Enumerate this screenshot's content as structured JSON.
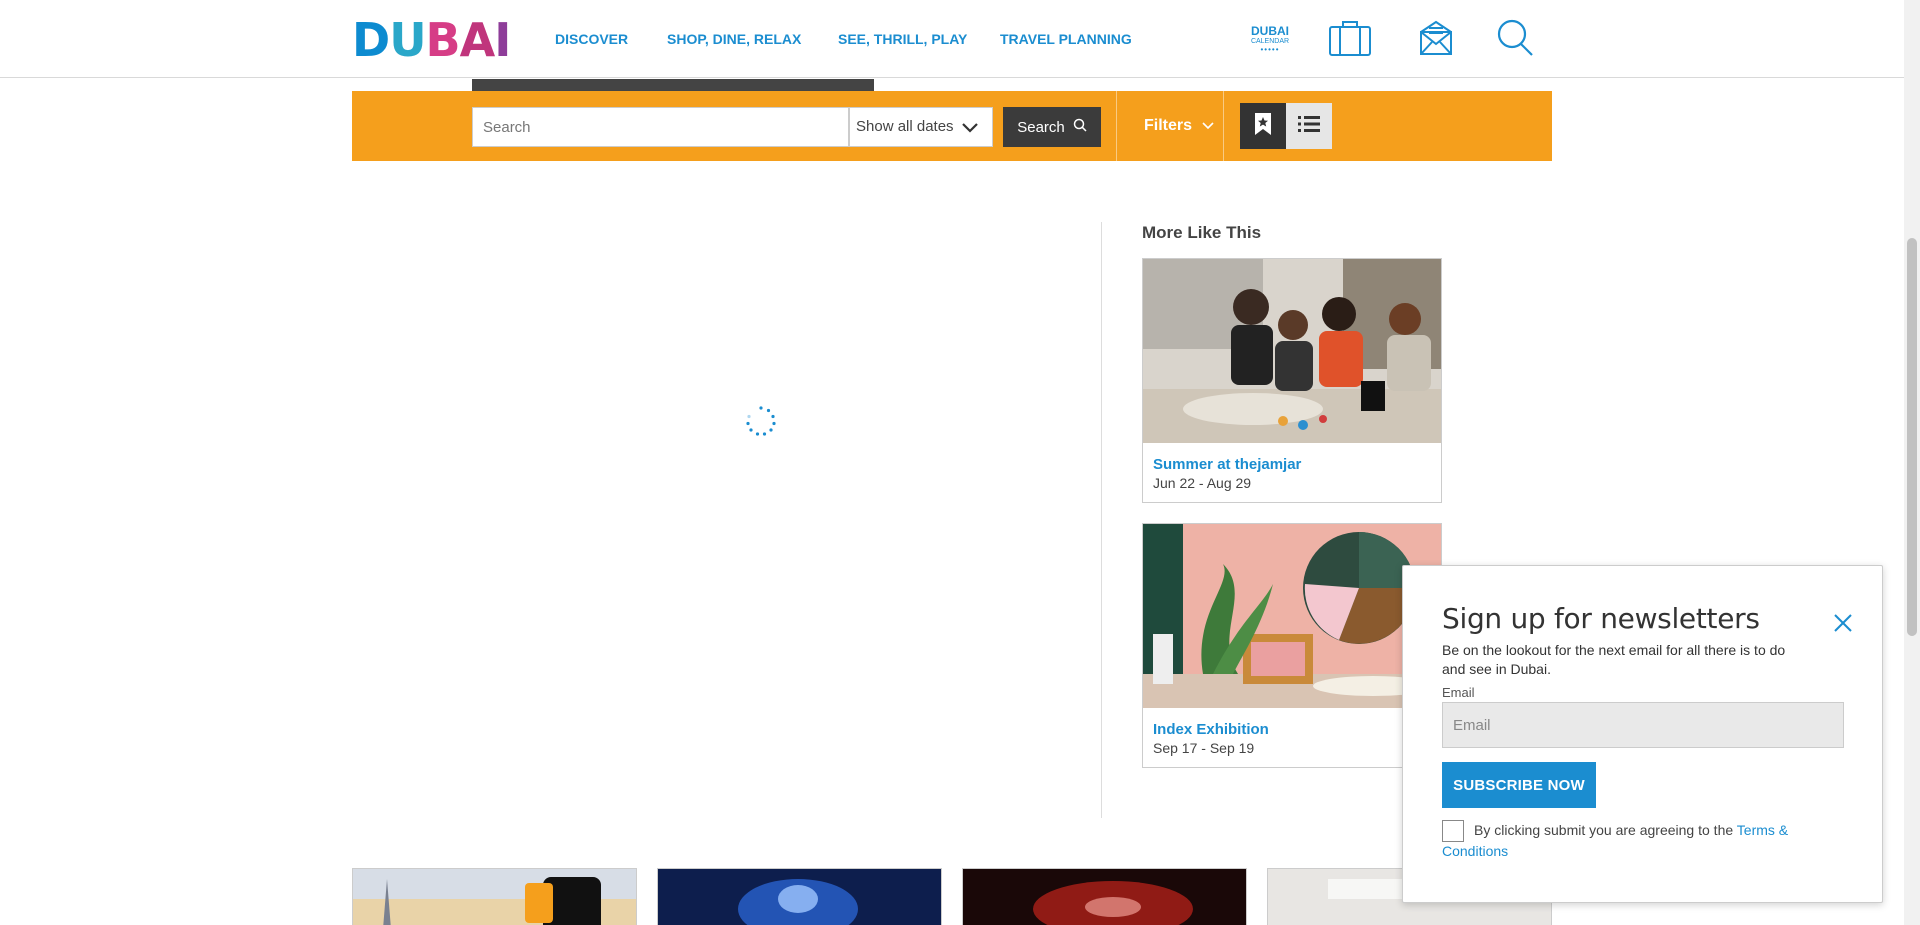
{
  "header": {
    "logo_text": "DUBAI",
    "nav": [
      {
        "label": "DISCOVER"
      },
      {
        "label": "SHOP, DINE, RELAX"
      },
      {
        "label": "SEE, THRILL, PLAY"
      },
      {
        "label": "TRAVEL PLANNING"
      }
    ],
    "calendar_badge": {
      "line1": "DUBAI",
      "line2": "CALENDAR"
    },
    "icons": [
      "suitcase-icon",
      "envelope-icon",
      "search-icon"
    ]
  },
  "search_bar": {
    "search_placeholder": "Search",
    "date_select": "Show all dates",
    "search_button": "Search",
    "filters_button": "Filters",
    "accent_color": "#f59f1c"
  },
  "more_like_this": {
    "title": "More Like This",
    "cards": [
      {
        "title": "Summer at thejamjar",
        "dates": "Jun 22 - Aug 29"
      },
      {
        "title": "Index Exhibition",
        "dates": "Sep 17 - Sep 19"
      }
    ]
  },
  "newsletter": {
    "title": "Sign up for newsletters",
    "description": "Be on the lookout for the next email for all there is to do and see in Dubai.",
    "email_label": "Email",
    "email_placeholder": "Email",
    "subscribe_button": "SUBSCRIBE NOW",
    "terms_prefix": "By clicking submit you are agreeing to the ",
    "terms_link": "Terms & Conditions",
    "brand_color": "#1b8dd0"
  }
}
